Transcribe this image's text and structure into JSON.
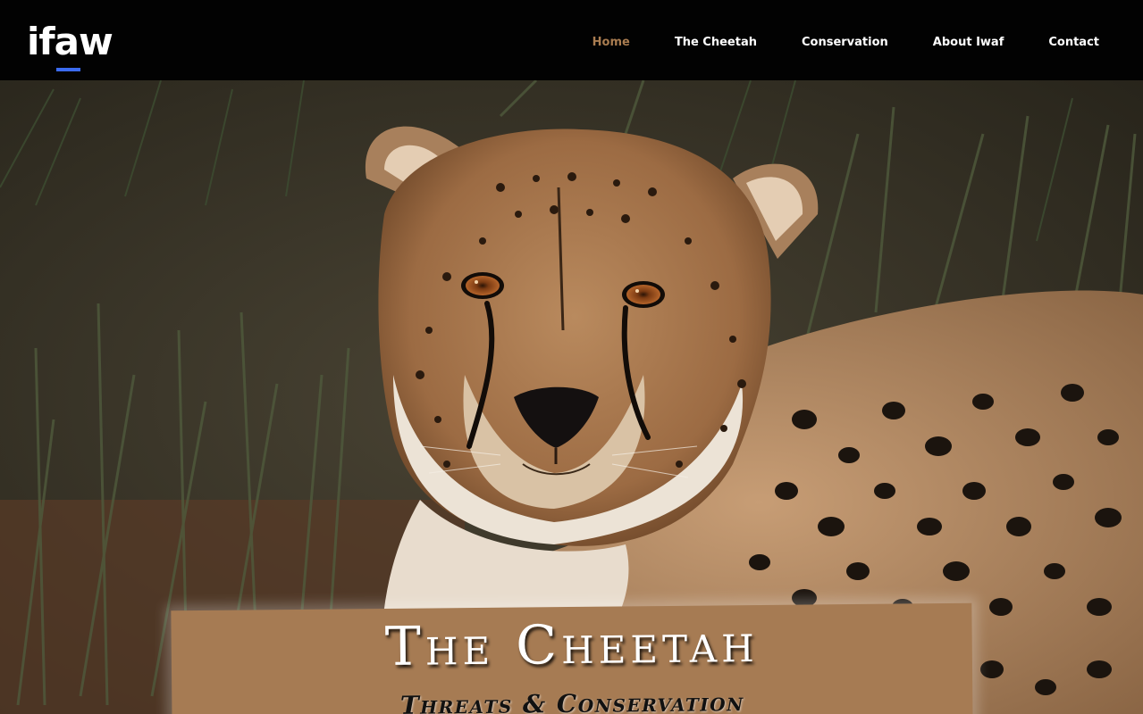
{
  "brand": {
    "logo_text": "ifaw",
    "accent": "#3b6bf0"
  },
  "nav": {
    "items": [
      {
        "label": "Home",
        "active": true
      },
      {
        "label": "The Cheetah",
        "active": false
      },
      {
        "label": "Conservation",
        "active": false
      },
      {
        "label": "About Iwaf",
        "active": false
      },
      {
        "label": "Contact",
        "active": false
      }
    ],
    "active_color": "#a97c50"
  },
  "hero": {
    "image_subject": "cheetah-photo",
    "title": "The Cheetah",
    "subtitle": "Threats & Conservation",
    "box_color": "#a67b53"
  }
}
